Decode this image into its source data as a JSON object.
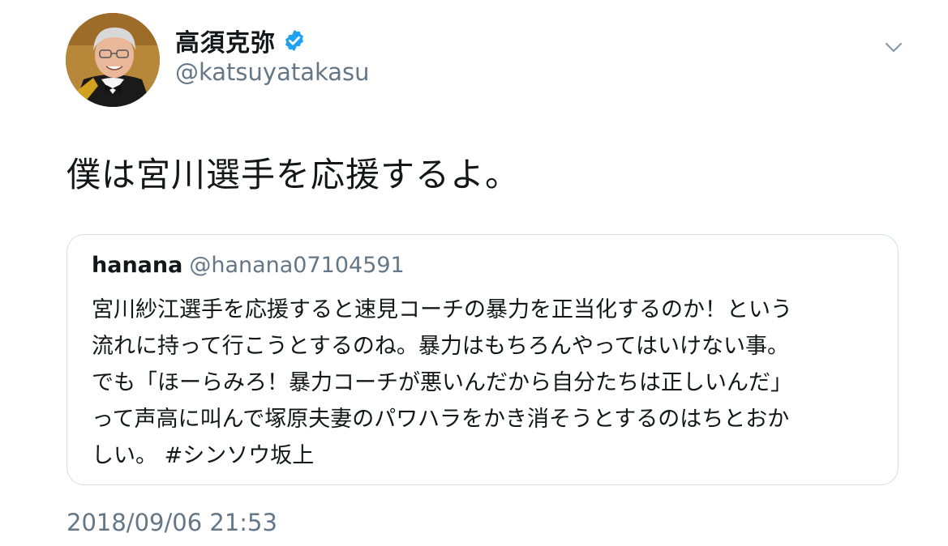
{
  "author": {
    "display_name": "高須克弥",
    "handle": "@katsuyatakasu",
    "verified": true,
    "avatar_icon": "profile-photo"
  },
  "tweet": {
    "text": "僕は宮川選手を応援するよ。",
    "timestamp": "2018/09/06 21:53"
  },
  "quoted_tweet": {
    "display_name": "hanana",
    "handle": "@hanana07104591",
    "lines": [
      "宮川紗江選手を応援すると速見コーチの暴力を正当化するのか！という",
      "流れに持って行こうとするのね。暴力はもちろんやってはいけない事。",
      "でも「ほーらみろ！暴力コーチが悪いんだから自分たちは正しいんだ」",
      "って声高に叫んで塚原夫妻のパワハラをかき消そうとするのはちとおか",
      "しい。 #シンソウ坂上"
    ]
  },
  "icons": {
    "verified": "verified-badge-icon",
    "menu": "chevron-down-icon"
  },
  "colors": {
    "text_primary": "#14171a",
    "text_secondary": "#657786",
    "verified_blue": "#1da1f2",
    "card_border": "#d7dde2"
  }
}
